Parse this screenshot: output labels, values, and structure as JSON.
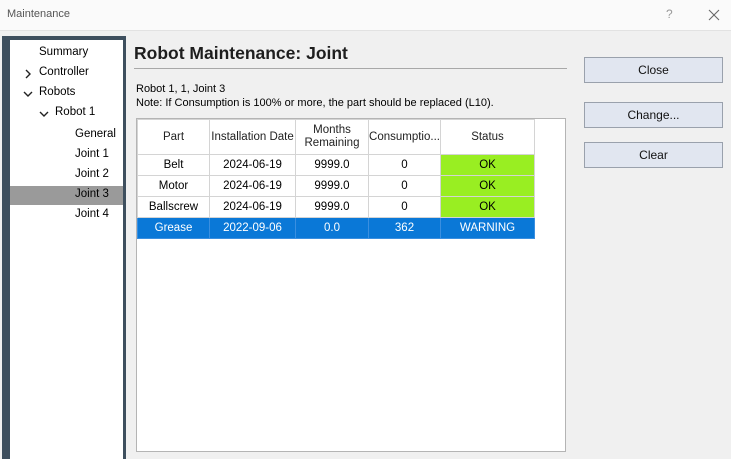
{
  "window": {
    "title": "Maintenance",
    "help_label": "?"
  },
  "nav": {
    "items": [
      {
        "label": "Summary"
      },
      {
        "label": "Controller"
      },
      {
        "label": "Robots"
      },
      {
        "label": "Robot 1"
      },
      {
        "label": "General"
      },
      {
        "label": "Joint 1"
      },
      {
        "label": "Joint 2"
      },
      {
        "label": "Joint 3"
      },
      {
        "label": "Joint 4"
      }
    ],
    "selected": "Joint 3"
  },
  "main": {
    "heading": "Robot Maintenance: Joint",
    "info_line1": "Robot 1, 1, Joint 3",
    "info_line2": "Note: If Consumption is 100% or more, the part should be replaced (L10)."
  },
  "table": {
    "headers": [
      "Part",
      "Installation Date",
      "Months Remaining",
      "Consumptio...",
      "Status"
    ],
    "rows": [
      {
        "part": "Belt",
        "date": "2024-06-19",
        "months": "9999.0",
        "consumption": "0",
        "status": "OK"
      },
      {
        "part": "Motor",
        "date": "2024-06-19",
        "months": "9999.0",
        "consumption": "0",
        "status": "OK"
      },
      {
        "part": "Ballscrew",
        "date": "2024-06-19",
        "months": "9999.0",
        "consumption": "0",
        "status": "OK"
      },
      {
        "part": "Grease",
        "date": "2022-09-06",
        "months": "0.0",
        "consumption": "362",
        "status": "WARNING"
      }
    ],
    "selected_row": "Grease"
  },
  "buttons": {
    "close": "Close",
    "change": "Change...",
    "clear": "Clear"
  },
  "colors": {
    "status_ok": "#99ee22",
    "status_warning": "#ffff00",
    "selection": "#0a78d7",
    "nav_frame": "#3e4f5e"
  }
}
